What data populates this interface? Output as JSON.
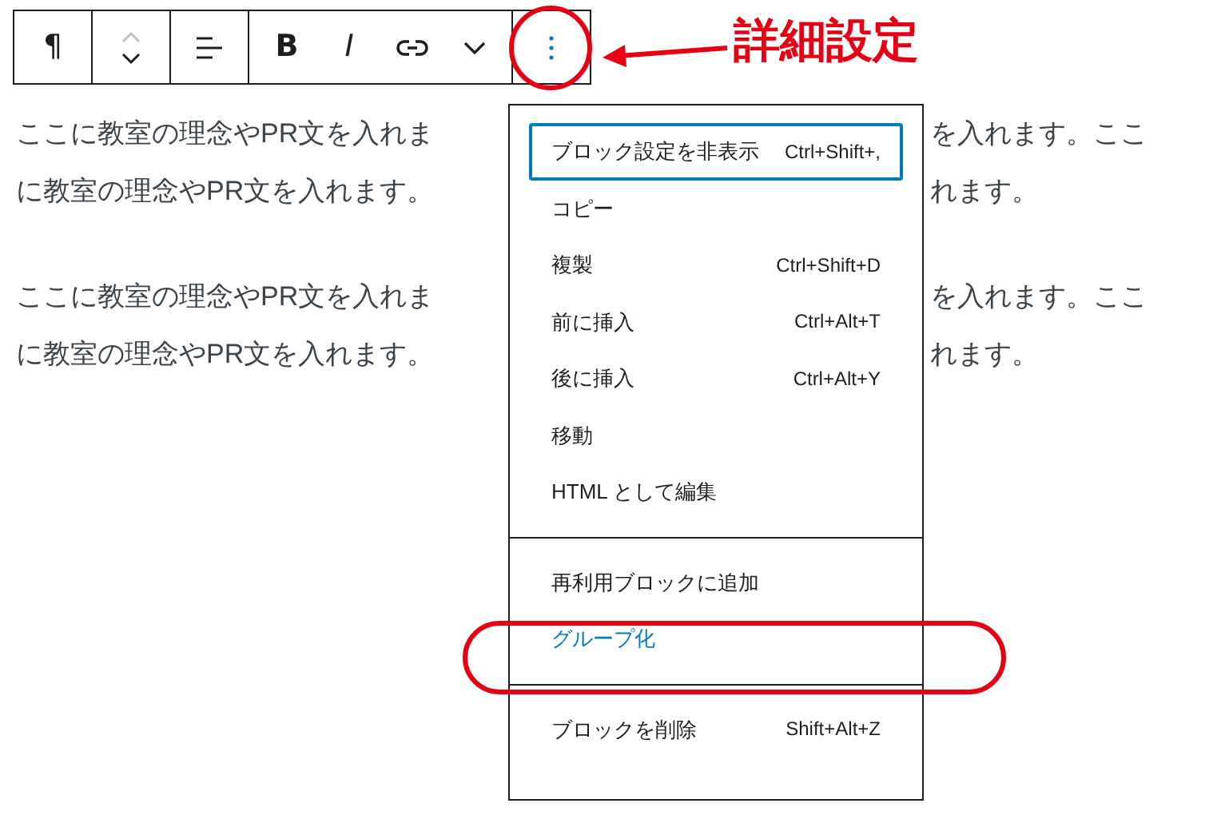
{
  "toolbar": {
    "groups": [
      [
        {
          "kind": "paragraph",
          "label": "¶"
        }
      ],
      [
        {
          "kind": "mover"
        }
      ],
      [
        {
          "kind": "align"
        }
      ],
      [
        {
          "kind": "bold",
          "label": "B"
        },
        {
          "kind": "italic",
          "label": "I"
        },
        {
          "kind": "link"
        },
        {
          "kind": "chevron"
        }
      ],
      [
        {
          "kind": "options",
          "pressed": true
        }
      ]
    ]
  },
  "paragraphs": [
    {
      "lines": [
        {
          "left": "ここに教室の理念やPR文を入れま",
          "right": "を入れます。ここ"
        },
        {
          "left": "に教室の理念やPR文を入れます。",
          "right": "れます。"
        }
      ]
    },
    {
      "lines": [
        {
          "left": "ここに教室の理念やPR文を入れま",
          "right": "を入れます。ここ"
        },
        {
          "left": "に教室の理念やPR文を入れます。",
          "right": "れます。"
        }
      ]
    }
  ],
  "menu": {
    "groups": [
      [
        {
          "label": "ブロック設定を非表示",
          "shortcut": "Ctrl+Shift+,",
          "selected": true,
          "active": false
        },
        {
          "label": "コピー",
          "selected": false,
          "active": false
        },
        {
          "label": "複製",
          "shortcut": "Ctrl+Shift+D",
          "selected": false,
          "active": false
        },
        {
          "label": "前に挿入",
          "shortcut": "Ctrl+Alt+T",
          "selected": false,
          "active": false
        },
        {
          "label": "後に挿入",
          "shortcut": "Ctrl+Alt+Y",
          "selected": false,
          "active": false
        },
        {
          "label": "移動",
          "selected": false,
          "active": false
        },
        {
          "label": "HTML として編集",
          "selected": false,
          "active": false
        }
      ],
      [
        {
          "label": "再利用ブロックに追加",
          "selected": false,
          "active": false
        },
        {
          "label": "グループ化",
          "selected": false,
          "active": true
        }
      ],
      [
        {
          "label": "ブロックを削除",
          "shortcut": "Shift+Alt+Z",
          "selected": false,
          "active": false
        }
      ]
    ]
  },
  "annotation": {
    "label": "詳細設定"
  }
}
